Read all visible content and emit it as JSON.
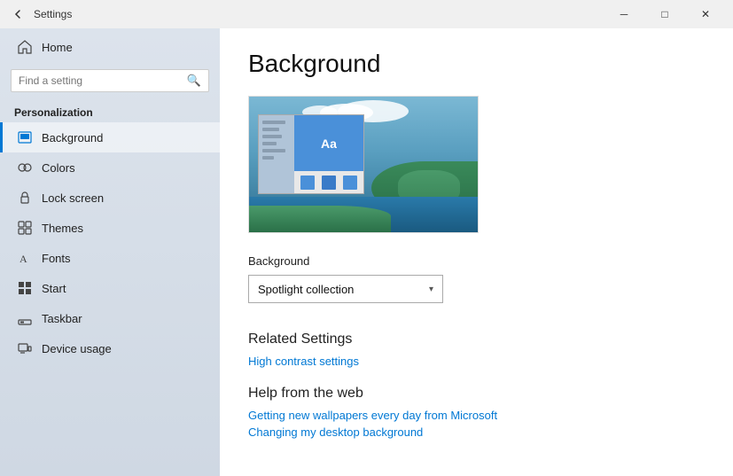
{
  "titlebar": {
    "back_label": "←",
    "title": "Settings",
    "minimize_label": "─",
    "maximize_label": "□",
    "close_label": "✕"
  },
  "sidebar": {
    "search_placeholder": "Find a setting",
    "section_label": "Personalization",
    "nav_items": [
      {
        "id": "home",
        "label": "Home",
        "icon": "home"
      },
      {
        "id": "background",
        "label": "Background",
        "icon": "background",
        "active": true
      },
      {
        "id": "colors",
        "label": "Colors",
        "icon": "colors"
      },
      {
        "id": "lock-screen",
        "label": "Lock screen",
        "icon": "lock"
      },
      {
        "id": "themes",
        "label": "Themes",
        "icon": "themes"
      },
      {
        "id": "fonts",
        "label": "Fonts",
        "icon": "fonts"
      },
      {
        "id": "start",
        "label": "Start",
        "icon": "start"
      },
      {
        "id": "taskbar",
        "label": "Taskbar",
        "icon": "taskbar"
      },
      {
        "id": "device-usage",
        "label": "Device usage",
        "icon": "device"
      }
    ]
  },
  "main": {
    "page_title": "Background",
    "setting_label": "Background",
    "dropdown_value": "Spotlight collection",
    "dropdown_arrow": "▾",
    "related_settings": {
      "title": "Related Settings",
      "links": [
        "High contrast settings"
      ]
    },
    "help": {
      "title": "Help from the web",
      "links": [
        "Getting new wallpapers every day from Microsoft",
        "Changing my desktop background"
      ]
    }
  }
}
